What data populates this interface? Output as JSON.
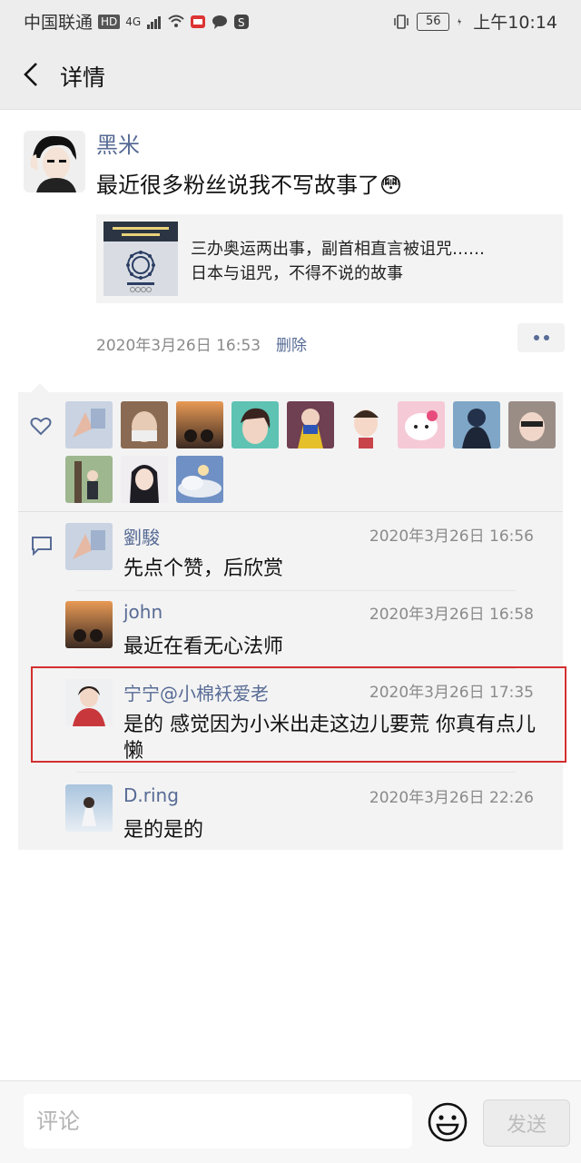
{
  "status_bar": {
    "carrier": "中国联通",
    "hd": "HD",
    "network": "4G",
    "battery": "56",
    "time": "上午10:14"
  },
  "nav": {
    "title": "详情"
  },
  "post": {
    "author": "黑米",
    "text": "最近很多粉丝说我不写故事了😳",
    "link": {
      "line1": "三办奥运两出事，副首相直言被诅咒……",
      "line2": "日本与诅咒，不得不说的故事"
    },
    "time": "2020年3月26日 16:53",
    "delete_label": "删除"
  },
  "likes": {
    "icon": "heart-icon",
    "avatar_colors": [
      "#b7c6dc",
      "#8a6a52",
      "#d8874a",
      "#d4b6a0",
      "#6f3f52",
      "#e9e9e9",
      "#f4c9d7",
      "#273a58",
      "#9a8d86",
      "#5c7b4a",
      "#3a3a44",
      "#7e9cc4"
    ]
  },
  "comments": [
    {
      "name": "劉駿",
      "time": "2020年3月26日 16:56",
      "text": "先点个赞，后欣赏",
      "avatar_color": "#b7c6dc"
    },
    {
      "name": "john",
      "time": "2020年3月26日 16:58",
      "text": "最近在看无心法师",
      "avatar_color": "#d8874a"
    },
    {
      "name": "宁宁@小棉袄爱老",
      "time": "2020年3月26日 17:35",
      "text": "是的 感觉因为小米出走这边儿要荒 你真有点儿懒",
      "avatar_color": "#c8373b"
    },
    {
      "name": "D.ring",
      "time": "2020年3月26日 22:26",
      "text": "是的是的",
      "avatar_color": "#a9c4dd"
    }
  ],
  "input": {
    "placeholder": "评论",
    "value": "",
    "send_label": "发送"
  },
  "colors": {
    "link_blue": "#576b95",
    "highlight_red": "#d32f2f",
    "panel_bg": "#f3f3f3"
  }
}
